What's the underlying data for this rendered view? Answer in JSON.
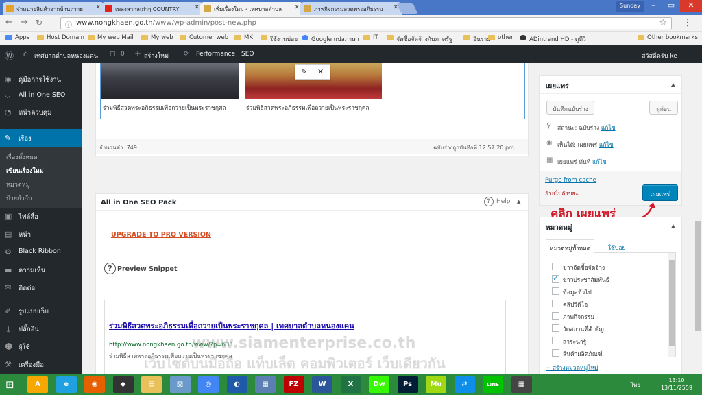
{
  "browser": {
    "tabs": [
      {
        "label": "จำหน่ายสินค้าจากบ้านถวาย",
        "color": "#e7a22e"
      },
      {
        "label": "เพลงสากลเก่าๆ COUNTRY",
        "color": "#e62117"
      },
      {
        "label": "เพิ่มเรื่องใหม่ ‹ เทศบาลตำบล",
        "color": "#d4a843"
      },
      {
        "label": "ภาพกิจกรรมสวดพระอภิธรรม",
        "color": "#d4a843"
      }
    ],
    "profile_label": "Sunday",
    "url_host": "www.nongkhaen.go.th",
    "url_path": "/www/wp-admin/post-new.php",
    "bookmarks": [
      "Apps",
      "Host Domain",
      "My web Mail",
      "My web",
      "Cutomer web",
      "MK",
      "ใช้งานบ่อย",
      "Google แปลภาษา",
      "IT",
      "จัดซื้อจัดจ้างกับภาครัฐ",
      "อินราม",
      "other",
      "ADintrend HD - ดูทีวี",
      "Other bookmarks"
    ]
  },
  "adminbar": {
    "site_name": "เทศบาลตำบลหนองแคน",
    "comments_count": "0",
    "new_label": "สร้างใหม่",
    "performance": "Performance",
    "seo": "SEO",
    "greeting": "สวัสดีครับ ke"
  },
  "sidebar": {
    "items": [
      {
        "label": "คู่มือการใช้งาน",
        "icon": "book-icon"
      },
      {
        "label": "All in One SEO",
        "icon": "shield-icon"
      },
      {
        "label": "หน้าควบคุม",
        "icon": "dashboard-icon"
      },
      {
        "label": "เรื่อง",
        "icon": "pin-icon"
      },
      {
        "label": "ไฟล์สื่อ",
        "icon": "media-icon"
      },
      {
        "label": "หน้า",
        "icon": "page-icon"
      },
      {
        "label": "Black Ribbon",
        "icon": "gear-icon"
      },
      {
        "label": "ความเห็น",
        "icon": "comment-icon"
      },
      {
        "label": "ติดต่อ",
        "icon": "mail-icon"
      },
      {
        "label": "รูปแบบเว็บ",
        "icon": "brush-icon"
      },
      {
        "label": "ปลั๊กอิน",
        "icon": "plugin-icon"
      },
      {
        "label": "ผู้ใช้",
        "icon": "user-icon"
      },
      {
        "label": "เครื่องมือ",
        "icon": "wrench-icon"
      }
    ],
    "submenu": [
      "เรื่องทั้งหมด",
      "เขียนเรื่องใหม่",
      "หมวดหมู่",
      "ป้ายกำกับ"
    ]
  },
  "editor": {
    "caption1": "ร่วมพิธีสวดพระอภิธรรมเพื่อถวายเป็นพระราชกุศล",
    "caption2": "ร่วมพิธีสวดพระอภิธรรมเพื่อถวายเป็นพระราชกุศล",
    "word_count": "จำนวนคำ: 749",
    "draft_saved": "ฉบับร่างถูกบันทึกที่ 12:57:20 pm"
  },
  "seo": {
    "title": "All in One SEO Pack",
    "help": "Help",
    "upgrade": "UPGRADE TO PRO VERSION",
    "preview": "Preview Snippet",
    "snippet_title": "ร่วมพิธีสวดพระอภิธรรมเพื่อถวายเป็นพระราชกุศล | เทศบาลตำบลหนองแคน",
    "snippet_url": "http://www.nongkhaen.go.th/www/?p=633",
    "snippet_desc": "ร่วมพิธีสวดพระอภิธรรมเพื่อถวายเป็นพระราชกุศล"
  },
  "publish": {
    "title": "เผยแพร่",
    "save_draft": "บันทึกฉบับร่าง",
    "preview": "ดูก่อน",
    "status_label": "สถานะ: ฉบับร่าง",
    "visibility_label": "เห็นได้: เผยแพร่",
    "schedule_label": "เผยแพร่ ทันที",
    "edit": "แก้ไข",
    "purge": "Purge from cache",
    "trash": "ย้ายไปถังขยะ",
    "publish_btn": "เผยแพร่",
    "callout": "คลิก เผยแพร่"
  },
  "categories": {
    "title": "หมวดหมู่",
    "tab_all": "หมวดหมู่ทั้งหมด",
    "tab_popular": "ใช้บ่อย",
    "items": [
      {
        "label": "ข่าวจัดซื้อจัดจ้าง",
        "checked": false
      },
      {
        "label": "ข่าวประชาสัมพันธ์",
        "checked": true
      },
      {
        "label": "ข้อมูลทั่วไป",
        "checked": false
      },
      {
        "label": "คลิปวีดีโอ",
        "checked": false
      },
      {
        "label": "ภาพกิจกรรม",
        "checked": false
      },
      {
        "label": "วัดสถานที่สำคัญ",
        "checked": false
      },
      {
        "label": "สาระน่ารู้",
        "checked": false
      },
      {
        "label": "สินค้าผลิตภัณฑ์",
        "checked": false
      }
    ],
    "add_new": "+ สร้างหมวดหมู่ใหม่"
  },
  "watermark": {
    "line1": "www.siamenterprise.co.th",
    "line2": "เว็บไซต์บนมือถือ แท็บเล็ต คอมพิวเตอร์ เว็บเดียวกัน"
  },
  "taskbar": {
    "apps": [
      {
        "name": "archicad-icon",
        "label": "A",
        "color": "#f6a800"
      },
      {
        "name": "ie-icon",
        "label": "e",
        "color": "#1fa0e0"
      },
      {
        "name": "firefox-icon",
        "label": "◉",
        "color": "#e66000"
      },
      {
        "name": "inkscape-icon",
        "label": "◆",
        "color": "#333333"
      },
      {
        "name": "explorer-icon",
        "label": "▤",
        "color": "#e8c15a"
      },
      {
        "name": "app-icon",
        "label": "▧",
        "color": "#6a9ac9"
      },
      {
        "name": "chrome-icon",
        "label": "◎",
        "color": "#4285f4"
      },
      {
        "name": "network-icon",
        "label": "◐",
        "color": "#1e5aa8"
      },
      {
        "name": "calc-icon",
        "label": "▦",
        "color": "#5b7fb0"
      },
      {
        "name": "filezilla-icon",
        "label": "FZ",
        "color": "#bf0000"
      },
      {
        "name": "word-icon",
        "label": "W",
        "color": "#2b579a"
      },
      {
        "name": "excel-icon",
        "label": "X",
        "color": "#217346"
      },
      {
        "name": "dreamweaver-icon",
        "label": "Dw",
        "color": "#35fa00"
      },
      {
        "name": "photoshop-icon",
        "label": "Ps",
        "color": "#001e36"
      },
      {
        "name": "muse-icon",
        "label": "Mu",
        "color": "#a0d911"
      },
      {
        "name": "teamviewer-icon",
        "label": "⇄",
        "color": "#0e8ee9"
      },
      {
        "name": "line-icon",
        "label": "LINE",
        "color": "#00c300"
      },
      {
        "name": "calculator-icon",
        "label": "▦",
        "color": "#444444"
      }
    ],
    "lang": "ไทย",
    "time": "13:10",
    "date": "13/11/2559"
  }
}
